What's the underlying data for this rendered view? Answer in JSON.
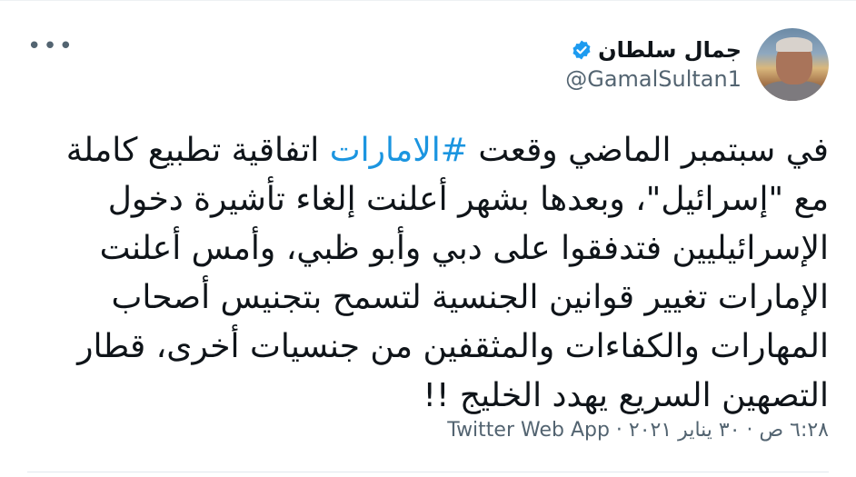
{
  "user": {
    "display_name": "جمال سلطان",
    "handle": "@GamalSultan1",
    "verified": true,
    "avatar_icon": "profile-photo"
  },
  "menu": {
    "more_glyph": "•••"
  },
  "tweet": {
    "text_before_hashtag": "في سبتمبر الماضي وقعت ",
    "hashtag": "#الامارات",
    "text_after_hashtag": " اتفاقية تطبيع كاملة مع \"إسرائيل\"، وبعدها بشهر أعلنت إلغاء تأشيرة دخول الإسرائيليين فتدفقوا على دبي وأبو ظبي، وأمس أعلنت الإمارات تغيير قوانين الجنسية لتسمح بتجنيس أصحاب المهارات والكفاءات والمثقفين من جنسيات أخرى، قطار التصهين السريع يهدد الخليج !!"
  },
  "meta": {
    "time": "٦:٢٨ ص",
    "separator1": " · ",
    "date": "٣٠ يناير ٢٠٢١",
    "separator2": " · ",
    "source": "Twitter Web App"
  },
  "colors": {
    "link": "#1b95e0",
    "text": "#0f1419",
    "secondary": "#536471",
    "verified": "#1d9bf0"
  }
}
